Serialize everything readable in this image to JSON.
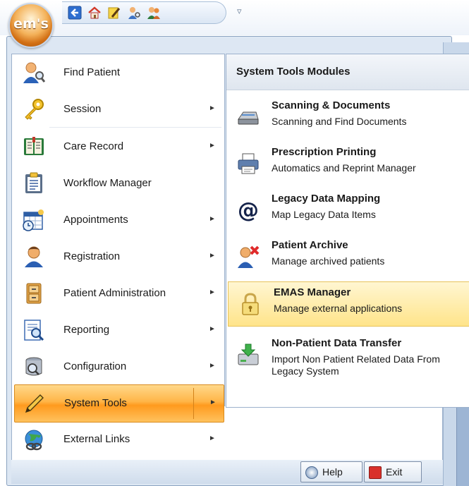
{
  "app": {
    "logo_text": "em's"
  },
  "quick_access": {
    "icons": [
      "back-arrow-icon",
      "home-icon",
      "notepad-pencil-icon",
      "patient-search-icon",
      "users-icon"
    ],
    "customize_glyph": "▿"
  },
  "menu": {
    "items": [
      {
        "label": "Find Patient",
        "icon": "find-patient-icon",
        "has_submenu": false
      },
      {
        "label": "Session",
        "icon": "key-icon",
        "has_submenu": true
      },
      {
        "label": "Care Record",
        "icon": "book-icon",
        "has_submenu": true
      },
      {
        "label": "Workflow Manager",
        "icon": "clipboard-icon",
        "has_submenu": false
      },
      {
        "label": "Appointments",
        "icon": "calendar-clock-icon",
        "has_submenu": true
      },
      {
        "label": "Registration",
        "icon": "person-icon",
        "has_submenu": true
      },
      {
        "label": "Patient Administration",
        "icon": "file-cabinet-icon",
        "has_submenu": true
      },
      {
        "label": "Reporting",
        "icon": "report-magnifier-icon",
        "has_submenu": true
      },
      {
        "label": "Configuration",
        "icon": "database-icon",
        "has_submenu": true
      },
      {
        "label": "System Tools",
        "icon": "pencil-icon",
        "has_submenu": true,
        "active": true
      },
      {
        "label": "External Links",
        "icon": "globe-link-icon",
        "has_submenu": true
      }
    ],
    "submenu_arrow": "►"
  },
  "submenu": {
    "heading": "System Tools Modules",
    "items": [
      {
        "title": "Scanning & Documents",
        "desc": "Scanning and Find Documents",
        "icon": "scanner-icon"
      },
      {
        "title": "Prescription Printing",
        "desc": "Automatics and Reprint Manager",
        "icon": "printer-icon"
      },
      {
        "title": "Legacy Data Mapping",
        "desc": "Map Legacy Data Items",
        "icon": "at-sign-icon"
      },
      {
        "title": "Patient Archive",
        "desc": "Manage archived patients",
        "icon": "patient-archive-icon"
      },
      {
        "title": "EMAS Manager",
        "desc": "Manage external applications",
        "icon": "padlock-icon",
        "highlighted": true
      },
      {
        "title": "Non-Patient Data Transfer",
        "desc": "Import Non Patient Related Data From Legacy System",
        "icon": "drive-download-icon"
      }
    ]
  },
  "footer": {
    "help_label": "Help",
    "exit_label": "Exit"
  },
  "colors": {
    "active_orange": "#ffb547",
    "highlight_yellow": "#ffe48a",
    "frame_blue": "#dde7f3",
    "border_blue": "#8aa2c0"
  }
}
